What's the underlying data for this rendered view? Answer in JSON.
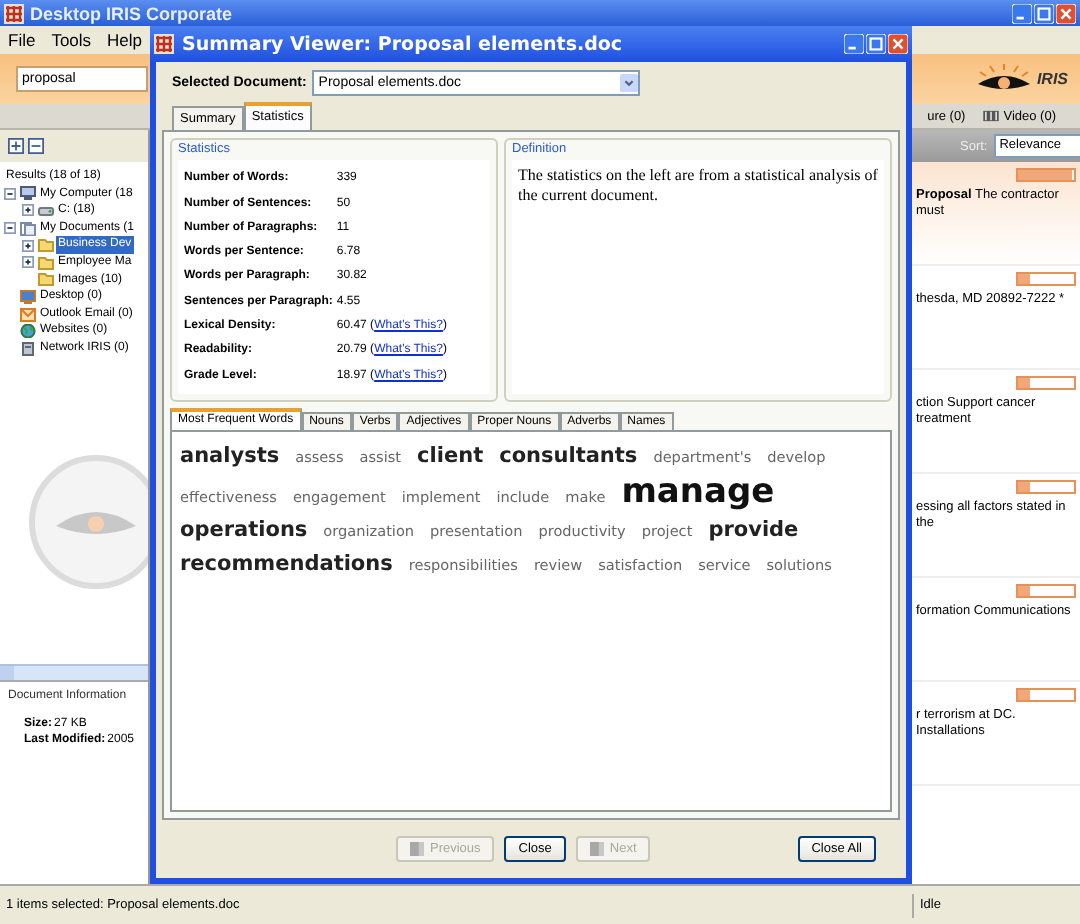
{
  "app": {
    "title": "Desktop IRIS Corporate",
    "menu": [
      "File",
      "Tools",
      "Help"
    ],
    "search": {
      "value": "proposal"
    },
    "logo_text": "IRIS",
    "filters": [
      {
        "label": "ure (0)"
      },
      {
        "label": "Video (0)",
        "kind": "video"
      }
    ],
    "sort": {
      "label": "Sort:",
      "value": "Relevance"
    },
    "tree": {
      "heading": "Results (18 of 18)",
      "items": [
        {
          "label": "My Computer (18",
          "kind": "computer",
          "expanded": true,
          "selected": false,
          "children": [
            {
              "label": "C: (18)",
              "kind": "drive",
              "expanded": false,
              "selected": false
            }
          ]
        },
        {
          "label": "My Documents (1",
          "kind": "documents",
          "expanded": true,
          "selected": false,
          "children": [
            {
              "label": "Business Dev",
              "kind": "folder",
              "expanded": false,
              "selected": true
            },
            {
              "label": "Employee Ma",
              "kind": "folder",
              "expanded": false,
              "selected": false
            },
            {
              "label": "Images (10)",
              "kind": "folder",
              "selected": false
            }
          ]
        },
        {
          "label": "Desktop (0)",
          "kind": "desktop",
          "selected": false
        },
        {
          "label": "Outlook Email (0)",
          "kind": "email",
          "selected": false
        },
        {
          "label": "Websites (0)",
          "kind": "web",
          "selected": false
        },
        {
          "label": "Network IRIS (0)",
          "kind": "network",
          "selected": false
        }
      ]
    },
    "document_info": {
      "title": "Document Information",
      "fields": [
        {
          "label": "Size:",
          "value": "27 KB"
        },
        {
          "label": "Last Modified:",
          "value": "2005"
        }
      ]
    },
    "results": [
      {
        "text": "**Proposal** The contractor must",
        "level": 0.95,
        "selected": true
      },
      {
        "text": "thesda, MD 20892-7222 *",
        "level": 0.2,
        "selected": false
      },
      {
        "text": "ction Support cancer treatment",
        "level": 0.2,
        "selected": false
      },
      {
        "text": "essing all factors stated in the",
        "level": 0.2,
        "selected": false
      },
      {
        "text": "formation Communications",
        "level": 0.2,
        "selected": false
      },
      {
        "text": "r terrorism at DC. Installations",
        "level": 0.2,
        "selected": false
      }
    ],
    "status_bar": {
      "message": "1 items selected: Proposal elements.doc",
      "state": "Idle"
    }
  },
  "dialog": {
    "title": "Summary Viewer: Proposal elements.doc",
    "document": {
      "label": "Selected Document:",
      "value": "Proposal elements.doc"
    },
    "tabs": [
      {
        "label": "Summary",
        "selected": false
      },
      {
        "label": "Statistics",
        "selected": true
      }
    ],
    "statistics": {
      "title": "Statistics",
      "rows": [
        {
          "label": "Number of Words:",
          "value": "339"
        },
        {
          "label": "Number of Sentences:",
          "value": "50"
        },
        {
          "label": "Number of Paragraphs:",
          "value": "11"
        },
        {
          "label": "Words per Sentence:",
          "value": "6.78"
        },
        {
          "label": "Words per Paragraph:",
          "value": "30.82"
        },
        {
          "label": "Sentences per Paragraph:",
          "value": "4.55"
        },
        {
          "label": "Lexical Density:",
          "value": "60.47 (",
          "link": "What's This?",
          "after": ")"
        },
        {
          "label": "Readability:",
          "value": "20.79 (",
          "link": "What's This?",
          "after": ")"
        },
        {
          "label": "Grade Level:",
          "value": "18.97 (",
          "link": "What's This?",
          "after": ")"
        }
      ]
    },
    "definition": {
      "title": "Definition",
      "text": "The statistics on the left are from a statistical analysis of the current document."
    },
    "word_tabs": [
      {
        "label": "Most Frequent Words",
        "selected": true
      },
      {
        "label": "Nouns",
        "selected": false
      },
      {
        "label": "Verbs",
        "selected": false
      },
      {
        "label": "Adjectives",
        "selected": false
      },
      {
        "label": "Proper Nouns",
        "selected": false
      },
      {
        "label": "Adverbs",
        "selected": false
      },
      {
        "label": "Names",
        "selected": false
      }
    ],
    "words": [
      {
        "text": "analysts",
        "kind": "large"
      },
      {
        "text": "assess",
        "kind": "small"
      },
      {
        "text": "assist",
        "kind": "small"
      },
      {
        "text": "client",
        "kind": "large"
      },
      {
        "text": "consultants",
        "kind": "large"
      },
      {
        "text": "department's",
        "kind": "small"
      },
      {
        "text": "develop",
        "kind": "small"
      },
      {
        "text": "effectiveness",
        "kind": "small"
      },
      {
        "text": "engagement",
        "kind": "small"
      },
      {
        "text": "implement",
        "kind": "small"
      },
      {
        "text": "include",
        "kind": "small"
      },
      {
        "text": "make",
        "kind": "small"
      },
      {
        "text": "manage",
        "kind": "huge"
      },
      {
        "text": "operations",
        "kind": "large"
      },
      {
        "text": "organization",
        "kind": "small"
      },
      {
        "text": "presentation",
        "kind": "small"
      },
      {
        "text": "productivity",
        "kind": "small"
      },
      {
        "text": "project",
        "kind": "small"
      },
      {
        "text": "provide",
        "kind": "large"
      },
      {
        "text": "recommendations",
        "kind": "large"
      },
      {
        "text": "responsibilities",
        "kind": "small"
      },
      {
        "text": "review",
        "kind": "small"
      },
      {
        "text": "satisfaction",
        "kind": "small"
      },
      {
        "text": "service",
        "kind": "small"
      },
      {
        "text": "solutions",
        "kind": "small"
      }
    ],
    "nav_buttons": [
      {
        "label": "Previous",
        "kind": "step",
        "disabled": true
      },
      {
        "label": "Close",
        "kind": "plain",
        "disabled": false
      },
      {
        "label": "Next",
        "kind": "step",
        "disabled": true
      }
    ],
    "close_all": {
      "label": "Close All",
      "disabled": false
    }
  }
}
